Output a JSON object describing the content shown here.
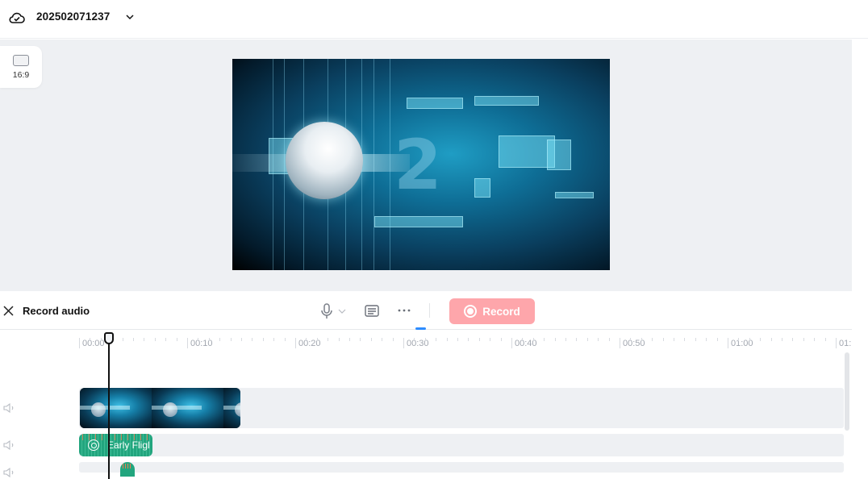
{
  "header": {
    "project_title": "202502071237",
    "icons": {
      "cloud": "cloud-check-icon",
      "dropdown": "chevron-down-icon"
    }
  },
  "canvas": {
    "aspect_ratio_label": "16:9",
    "preview": {
      "description": "Futuristic blue tech background with globe and number 2",
      "overlay_digit": "2"
    }
  },
  "record_bar": {
    "title": "Record audio",
    "record_label": "Record",
    "record_color": "#fea6ab",
    "icons": [
      "close-icon",
      "microphone-icon",
      "chevron-down-icon",
      "subtitle-icon",
      "more-icon"
    ]
  },
  "timeline": {
    "ruler_labels": [
      "00:00",
      "00:10",
      "00:20",
      "00:30",
      "00:40",
      "00:50",
      "01:00",
      "01:"
    ],
    "playhead_time": "00:00",
    "tracks": [
      {
        "type": "video",
        "clip": "Video clip"
      },
      {
        "type": "audio",
        "clip": "Early Fligl"
      },
      {
        "type": "audio",
        "clip": ""
      }
    ],
    "accent_color": "#2d8cff",
    "audio_clip_color": "#22a57e"
  }
}
